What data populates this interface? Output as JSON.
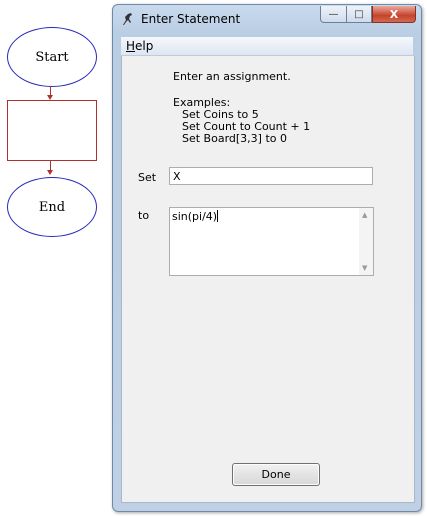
{
  "flowchart": {
    "start_label": "Start",
    "end_label": "End"
  },
  "window": {
    "title": "Enter Statement",
    "controls": {
      "minimize": "—",
      "maximize": "□",
      "close": "X"
    }
  },
  "menu": {
    "help": "Help"
  },
  "dialog": {
    "instruction": "Enter an assignment.",
    "examples_header": "Examples:",
    "examples": [
      "Set Coins to 5",
      "Set Count to Count + 1",
      "Set Board[3,3] to 0"
    ],
    "set_label": "Set",
    "set_value": "X",
    "to_label": "to",
    "to_value": "sin(pi/4)",
    "done_label": "Done"
  }
}
